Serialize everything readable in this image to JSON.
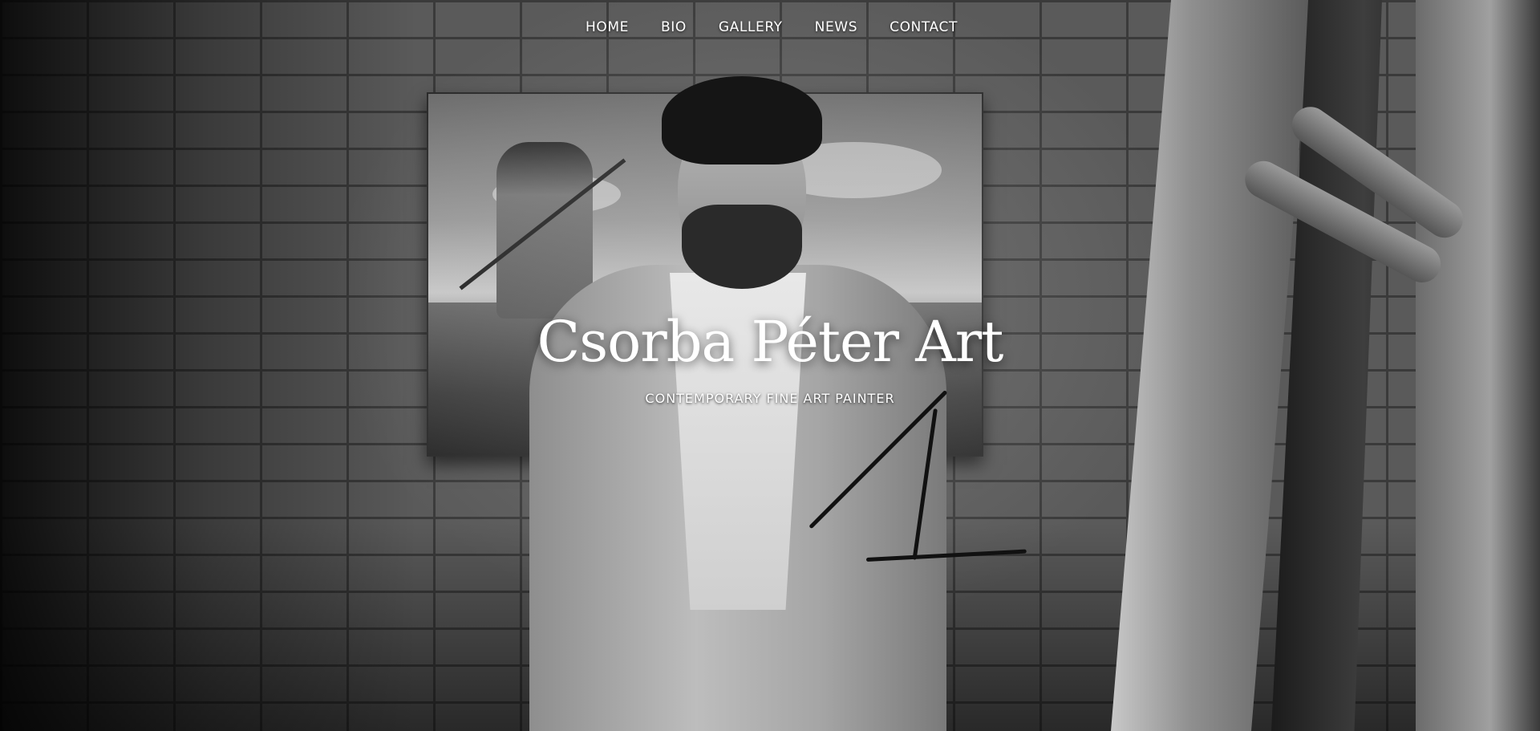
{
  "nav": {
    "items": [
      {
        "label": "HOME"
      },
      {
        "label": "BIO"
      },
      {
        "label": "GALLERY"
      },
      {
        "label": "NEWS"
      },
      {
        "label": "CONTACT"
      }
    ]
  },
  "hero": {
    "title": "Csorba Péter Art",
    "subtitle": "CONTEMPORARY FINE ART PAINTER"
  },
  "colors": {
    "text": "#ffffff",
    "background": "#2a2a2a"
  }
}
